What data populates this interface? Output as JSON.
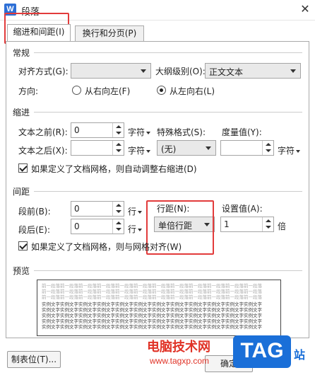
{
  "window": {
    "icon_letter": "W",
    "title": "段落",
    "close_label": "✕"
  },
  "tabs": [
    {
      "label": "缩进和间距(I)",
      "active": true
    },
    {
      "label": "换行和分页(P)",
      "active": false
    }
  ],
  "general": {
    "section_label": "常规",
    "alignment_label": "对齐方式(G):",
    "alignment_value": "",
    "outline_label": "大纲级别(O):",
    "outline_value": "正文文本",
    "direction_label": "方向:",
    "rtl_label": "从右向左(F)",
    "ltr_label": "从左向右(L)",
    "direction_selected": "ltr"
  },
  "indent": {
    "section_label": "缩进",
    "before_text_label": "文本之前(R):",
    "before_text_value": "0",
    "before_unit": "字符",
    "special_label": "特殊格式(S):",
    "special_value": "(无)",
    "measure_label": "度量值(Y):",
    "measure_value": "",
    "measure_unit": "字符",
    "after_text_label": "文本之后(X):",
    "after_text_value": "",
    "after_unit": "字符",
    "auto_adjust_label": "如果定义了文档网格，则自动调整右缩进(D)",
    "auto_adjust_checked": true
  },
  "spacing": {
    "section_label": "间距",
    "before_label": "段前(B):",
    "before_value": "0",
    "before_unit": "行",
    "after_label": "段后(E):",
    "after_value": "0",
    "after_unit": "行",
    "line_spacing_label": "行距(N):",
    "line_spacing_value": "单倍行距",
    "setting_label": "设置值(A):",
    "setting_value": "1",
    "setting_unit": "倍",
    "snap_grid_label": "如果定义了文档网格，则与网格对齐(W)",
    "snap_grid_checked": true
  },
  "preview": {
    "section_label": "预览",
    "prev_para_line": "前一段落前一段落前一段落前一段落前一段落前一段落前一段落前一段落前一段落前一段落前一段落前一段落",
    "sample_line": "实例文字实例文字实例文字实例文字实例文字实例文字实例文字实例文字实例文字实例文字实例文字实例文字"
  },
  "footer": {
    "tabs_button": "制表位(T)...",
    "ok_button": "确定"
  },
  "watermark": {
    "site_text": "电脑技术网",
    "url": "www.tagxp.com",
    "logo": "TAG",
    "suffix": "站"
  },
  "colors": {
    "highlight_red": "#e23b3b",
    "watermark_red": "#e03226",
    "watermark_blue": "#1a6fd8"
  }
}
